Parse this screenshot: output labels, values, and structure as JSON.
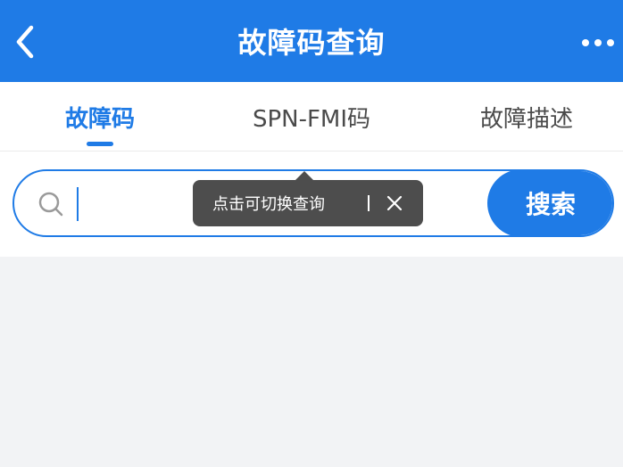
{
  "header": {
    "title": "故障码查询",
    "back_icon": "chevron-left-icon",
    "more_icon": "more-horizontal-icon",
    "background": "#1f7be6"
  },
  "tabs": [
    {
      "label": "故障码",
      "active": true
    },
    {
      "label": "SPN-FMI码",
      "active": false
    },
    {
      "label": "故障描述",
      "active": false
    }
  ],
  "search": {
    "placeholder": "",
    "value": "",
    "button_label": "搜索",
    "icon": "search-icon"
  },
  "tooltip": {
    "text": "点击可切换查询",
    "close_icon": "close-icon"
  },
  "colors": {
    "accent": "#1f7be6",
    "tooltip_bg": "#4d4d4d",
    "page_bg": "#f2f3f5"
  }
}
